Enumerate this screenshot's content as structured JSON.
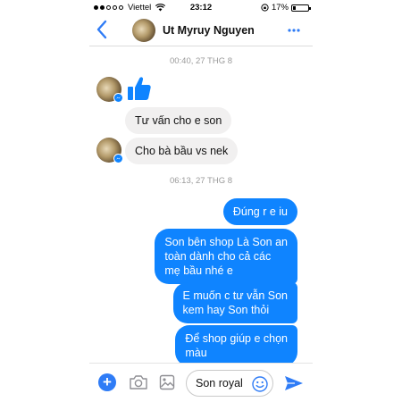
{
  "status_bar": {
    "carrier": "Viettel",
    "time": "23:12",
    "battery": "17%",
    "battery_level": 0.17
  },
  "header": {
    "title": "Ut Myruy Nguyen",
    "back_icon": "chevron-left-icon",
    "more_icon": "more-dots-icon"
  },
  "thread": {
    "timestamp_1": "00:40, 27 THG 8",
    "timestamp_2": "06:13, 27 THG 8",
    "incoming": [
      "Tư vấn cho e son",
      "Cho bà bầu vs nek"
    ],
    "outgoing": [
      "Đúng r e iu",
      "Son bên shop Là Son an\ntoàn dành cho cả các\nmẹ bầu nhé e",
      "E muốn c tư vẫn Son\nkem hay Son thỏi",
      "Để shop giúp e chọn\nmàu"
    ]
  },
  "composer": {
    "input_value": "Son royal",
    "icons": [
      "plus-icon",
      "camera-icon",
      "gallery-icon",
      "emoji-icon",
      "send-icon"
    ]
  },
  "colors": {
    "accent": "#2f7cf6",
    "outgoing_bubble": "#0f84ff",
    "incoming_bubble": "#f1f0f0"
  }
}
